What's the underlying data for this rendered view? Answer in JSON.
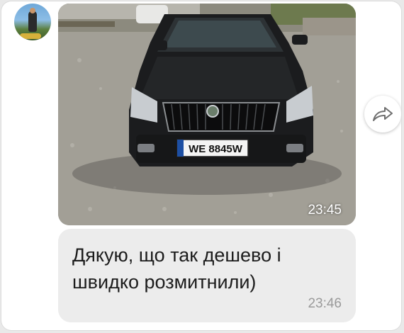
{
  "chat": {
    "avatar_icon": "profile-photo",
    "photo_message": {
      "image_alt": "car-photo",
      "plate": "WE 8845W",
      "time": "23:45"
    },
    "forward_icon": "share-arrow-icon",
    "text_message": {
      "line1": "Дякую, що так дешево і",
      "line2": "швидко розмитнили)",
      "time": "23:46"
    }
  },
  "colors": {
    "bubble_bg": "#ececec",
    "time_grey": "#9a9a9a",
    "text": "#1c1c1c"
  }
}
